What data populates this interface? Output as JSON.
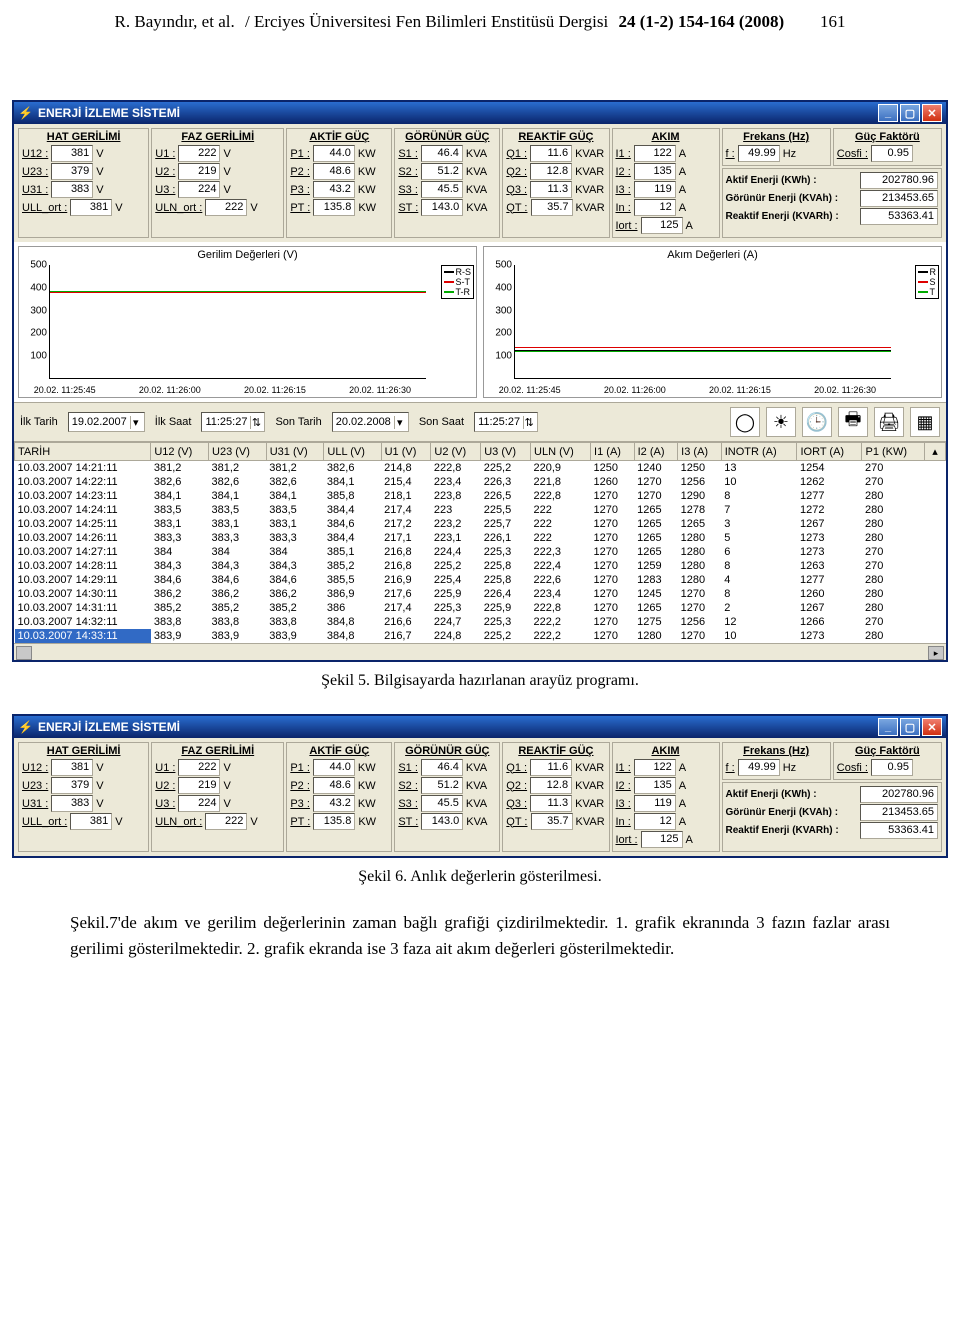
{
  "header": {
    "author": "R. Bayındır, et al.",
    "journal": "/ Erciyes Üniversitesi Fen Bilimleri Enstitüsü Dergisi",
    "issue": "24 (1-2) 154-164  (2008)",
    "page": "161"
  },
  "app": {
    "title": "ENERJİ İZLEME SİSTEMİ",
    "groups": {
      "hat": {
        "title": "HAT GERİLİMİ",
        "rows": [
          [
            "U12 :",
            "381",
            "V"
          ],
          [
            "U23 :",
            "379",
            "V"
          ],
          [
            "U31 :",
            "383",
            "V"
          ],
          [
            "ULL_ort :",
            "381",
            "V"
          ]
        ]
      },
      "faz": {
        "title": "FAZ GERİLİMİ",
        "rows": [
          [
            "U1 :",
            "222",
            "V"
          ],
          [
            "U2 :",
            "219",
            "V"
          ],
          [
            "U3 :",
            "224",
            "V"
          ],
          [
            "ULN_ort :",
            "222",
            "V"
          ]
        ]
      },
      "aktif": {
        "title": "AKTİF GÜÇ",
        "rows": [
          [
            "P1 :",
            "44.0",
            "KW"
          ],
          [
            "P2 :",
            "48.6",
            "KW"
          ],
          [
            "P3 :",
            "43.2",
            "KW"
          ],
          [
            "PT :",
            "135.8",
            "KW"
          ]
        ]
      },
      "gorun": {
        "title": "GÖRÜNÜR GÜÇ",
        "rows": [
          [
            "S1 :",
            "46.4",
            "KVA"
          ],
          [
            "S2 :",
            "51.2",
            "KVA"
          ],
          [
            "S3 :",
            "45.5",
            "KVA"
          ],
          [
            "ST :",
            "143.0",
            "KVA"
          ]
        ]
      },
      "reak": {
        "title": "REAKTİF GÜÇ",
        "rows": [
          [
            "Q1 :",
            "11.6",
            "KVAR"
          ],
          [
            "Q2 :",
            "12.8",
            "KVAR"
          ],
          [
            "Q3 :",
            "11.3",
            "KVAR"
          ],
          [
            "QT :",
            "35.7",
            "KVAR"
          ]
        ]
      },
      "akim": {
        "title": "AKIM",
        "rows": [
          [
            "I1 :",
            "122",
            "A"
          ],
          [
            "I2 :",
            "135",
            "A"
          ],
          [
            "I3 :",
            "119",
            "A"
          ],
          [
            "In :",
            "12",
            "A"
          ],
          [
            "Iort :",
            "125",
            "A"
          ]
        ]
      },
      "frek": {
        "title": "Frekans (Hz)",
        "lbl": "f :",
        "val": "49.99",
        "unit": "Hz"
      },
      "cosfi": {
        "title": "Güç Faktörü",
        "lbl": "Cosfi :",
        "val": "0.95"
      },
      "side": [
        [
          "Aktif Enerji (KWh) :",
          "202780.96"
        ],
        [
          "Görünür Enerji (KVAh) :",
          "213453.65"
        ],
        [
          "Reaktif Enerji (KVARh) :",
          "53363.41"
        ]
      ]
    },
    "filter": {
      "ilkTarihL": "İlk Tarih",
      "ilkTarihV": "19.02.2007",
      "ilkSaatL": "İlk Saat",
      "ilkSaatV": "11:25:27",
      "sonTarihL": "Son Tarih",
      "sonTarihV": "20.02.2008",
      "sonSaatL": "Son Saat",
      "sonSaatV": "11:25:27"
    },
    "icons": [
      "◯",
      "☀",
      "🕒",
      "🖶",
      "🖨",
      "▦"
    ],
    "grid": {
      "headers": [
        "TARİH",
        "U12 (V)",
        "U23 (V)",
        "U31 (V)",
        "ULL (V)",
        "U1 (V)",
        "U2 (V)",
        "U3 (V)",
        "ULN (V)",
        "I1 (A)",
        "I2 (A)",
        "I3 (A)",
        "INOTR (A)",
        "IORT (A)",
        "P1 (KW)"
      ],
      "rows": [
        [
          "10.03.2007 14:21:11",
          "381,2",
          "381,2",
          "381,2",
          "382,6",
          "214,8",
          "222,8",
          "225,2",
          "220,9",
          "1250",
          "1240",
          "1250",
          "13",
          "1254",
          "270"
        ],
        [
          "10.03.2007 14:22:11",
          "382,6",
          "382,6",
          "382,6",
          "384,1",
          "215,4",
          "223,4",
          "226,3",
          "221,8",
          "1260",
          "1270",
          "1256",
          "10",
          "1262",
          "270"
        ],
        [
          "10.03.2007 14:23:11",
          "384,1",
          "384,1",
          "384,1",
          "385,8",
          "218,1",
          "223,8",
          "226,5",
          "222,8",
          "1270",
          "1270",
          "1290",
          "8",
          "1277",
          "280"
        ],
        [
          "10.03.2007 14:24:11",
          "383,5",
          "383,5",
          "383,5",
          "384,4",
          "217,4",
          "223",
          "225,5",
          "222",
          "1270",
          "1265",
          "1278",
          "7",
          "1272",
          "280"
        ],
        [
          "10.03.2007 14:25:11",
          "383,1",
          "383,1",
          "383,1",
          "384,6",
          "217,2",
          "223,2",
          "225,7",
          "222",
          "1270",
          "1265",
          "1265",
          "3",
          "1267",
          "280"
        ],
        [
          "10.03.2007 14:26:11",
          "383,3",
          "383,3",
          "383,3",
          "384,4",
          "217,1",
          "223,1",
          "226,1",
          "222",
          "1270",
          "1265",
          "1280",
          "5",
          "1273",
          "280"
        ],
        [
          "10.03.2007 14:27:11",
          "384",
          "384",
          "384",
          "385,1",
          "216,8",
          "224,4",
          "225,3",
          "222,3",
          "1270",
          "1265",
          "1280",
          "6",
          "1273",
          "270"
        ],
        [
          "10.03.2007 14:28:11",
          "384,3",
          "384,3",
          "384,3",
          "385,2",
          "216,8",
          "225,2",
          "225,8",
          "222,4",
          "1270",
          "1259",
          "1280",
          "8",
          "1263",
          "270"
        ],
        [
          "10.03.2007 14:29:11",
          "384,6",
          "384,6",
          "384,6",
          "385,5",
          "216,9",
          "225,4",
          "225,8",
          "222,6",
          "1270",
          "1283",
          "1280",
          "4",
          "1277",
          "280"
        ],
        [
          "10.03.2007 14:30:11",
          "386,2",
          "386,2",
          "386,2",
          "386,9",
          "217,6",
          "225,9",
          "226,4",
          "223,4",
          "1270",
          "1245",
          "1270",
          "8",
          "1260",
          "280"
        ],
        [
          "10.03.2007 14:31:11",
          "385,2",
          "385,2",
          "385,2",
          "386",
          "217,4",
          "225,3",
          "225,9",
          "222,8",
          "1270",
          "1265",
          "1270",
          "2",
          "1267",
          "280"
        ],
        [
          "10.03.2007 14:32:11",
          "383,8",
          "383,8",
          "383,8",
          "384,8",
          "216,6",
          "224,7",
          "225,3",
          "222,2",
          "1270",
          "1275",
          "1256",
          "12",
          "1266",
          "270"
        ],
        [
          "10.03.2007 14:33:11",
          "383,9",
          "383,9",
          "383,9",
          "384,8",
          "216,7",
          "224,8",
          "225,2",
          "222,2",
          "1270",
          "1280",
          "1270",
          "10",
          "1273",
          "280"
        ]
      ],
      "selectedRow": 12
    }
  },
  "chart_data": [
    {
      "type": "line",
      "title": "Gerilim Değerleri (V)",
      "ylim": [
        0,
        500
      ],
      "yticks": [
        100,
        200,
        300,
        400,
        500
      ],
      "xticks": [
        "20.02. 11:25:45",
        "20.02. 11:26:00",
        "20.02. 11:26:15",
        "20.02. 11:26:30"
      ],
      "series": [
        {
          "name": "R-S",
          "color": "#000",
          "value": 381
        },
        {
          "name": "S-T",
          "color": "#d00",
          "value": 379
        },
        {
          "name": "T-R",
          "color": "#0a0",
          "value": 383
        }
      ]
    },
    {
      "type": "line",
      "title": "Akım Değerleri (A)",
      "ylim": [
        0,
        500
      ],
      "yticks": [
        100,
        200,
        300,
        400,
        500
      ],
      "xticks": [
        "20.02. 11:25:45",
        "20.02. 11:26:00",
        "20.02. 11:26:15",
        "20.02. 11:26:30"
      ],
      "series": [
        {
          "name": "R",
          "color": "#000",
          "value": 122
        },
        {
          "name": "S",
          "color": "#d00",
          "value": 135
        },
        {
          "name": "T",
          "color": "#0a0",
          "value": 119
        }
      ]
    }
  ],
  "captions": {
    "c5": "Şekil 5. Bilgisayarda hazırlanan arayüz programı.",
    "c6": "Şekil 6. Anlık değerlerin gösterilmesi.",
    "body": "Şekil.7'de akım ve gerilim değerlerinin zaman bağlı grafiği çizdirilmektedir. 1. grafik ekranında 3 fazın fazlar arası gerilimi gösterilmektedir. 2. grafik ekranda ise 3 faza ait akım değerleri gösterilmektedir."
  }
}
